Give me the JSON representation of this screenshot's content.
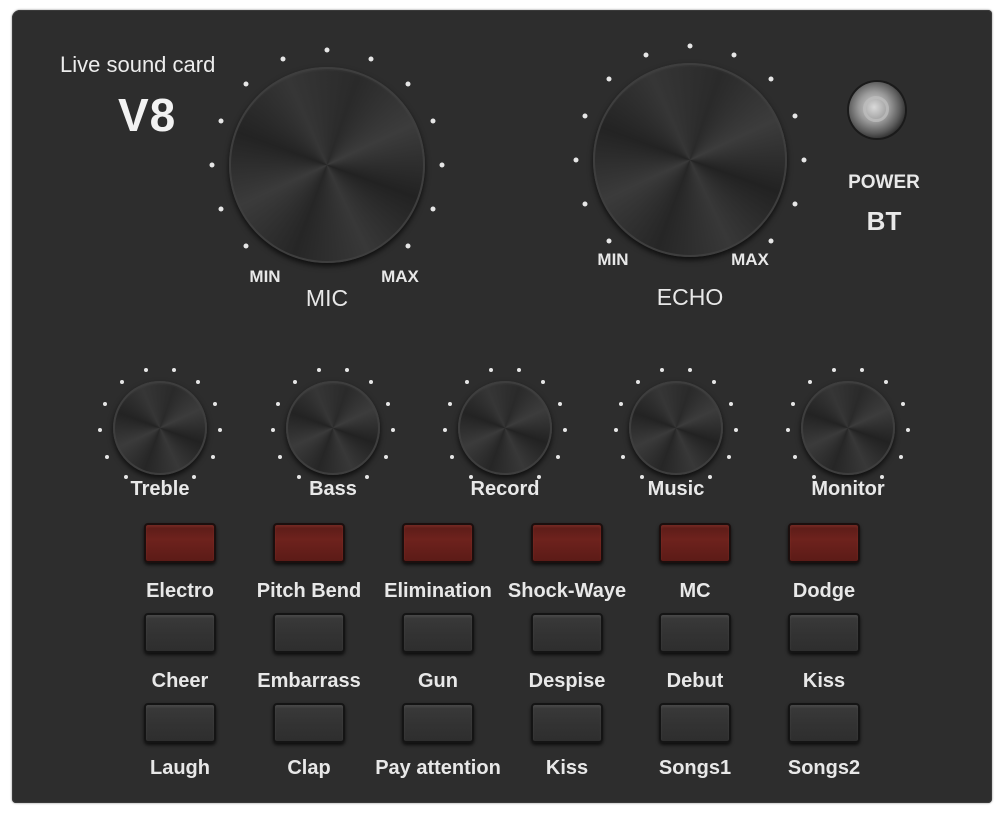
{
  "device": {
    "brand_subtitle": "Live sound card",
    "model": "V8",
    "body_color": "#2d2d2d",
    "label_color": "#e8e8e8",
    "led_button_color": "#6e221d"
  },
  "power": {
    "label": "POWER",
    "sublabel": "BT",
    "icon": "power-button-icon"
  },
  "large_knobs": [
    {
      "id": "mic",
      "label": "MIC",
      "min_label": "MIN",
      "max_label": "MAX"
    },
    {
      "id": "echo",
      "label": "ECHO",
      "min_label": "MIN",
      "max_label": "MAX"
    }
  ],
  "small_knobs": [
    {
      "id": "treble",
      "label": "Treble"
    },
    {
      "id": "bass",
      "label": "Bass"
    },
    {
      "id": "record",
      "label": "Record"
    },
    {
      "id": "music",
      "label": "Music"
    },
    {
      "id": "monitor",
      "label": "Monitor"
    }
  ],
  "button_rows": [
    {
      "style": "red",
      "labels": [
        "Electro",
        "Pitch Bend",
        "Elimination",
        "Shock-Waye",
        "MC",
        "Dodge"
      ]
    },
    {
      "style": "black",
      "labels": [
        "Cheer",
        "Embarrass",
        "Gun",
        "Despise",
        "Debut",
        "Kiss"
      ]
    },
    {
      "style": "black",
      "labels": [
        "Laugh",
        "Clap",
        "Pay attention",
        "Kiss",
        "Songs1",
        "Songs2"
      ]
    }
  ]
}
